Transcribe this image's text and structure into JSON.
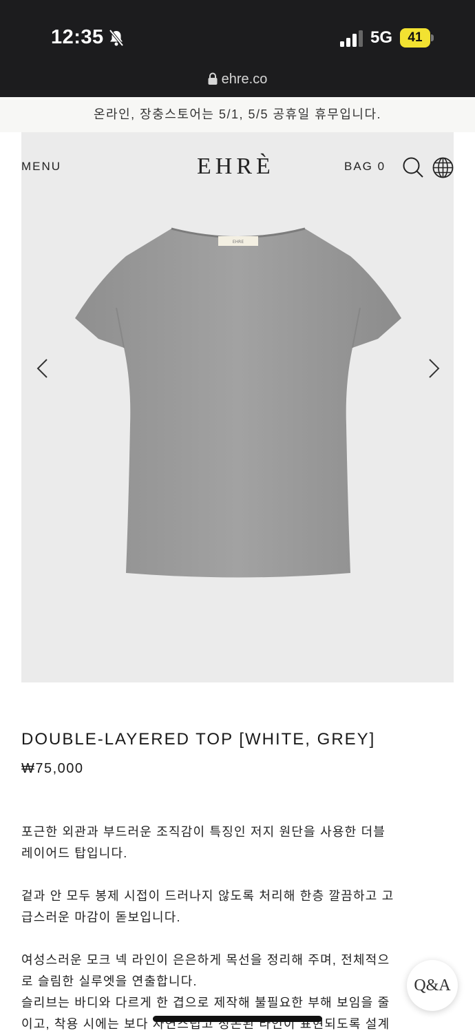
{
  "status_bar": {
    "time": "12:35",
    "network": "5G",
    "battery": "41",
    "bell_icon": "bell-slash-icon",
    "signal_icon": "cellular-signal-icon"
  },
  "url_bar": {
    "domain": "ehre.co",
    "lock_icon": "lock-icon"
  },
  "announcement": "온라인, 장충스토어는 5/1, 5/5 공휴일 휴무입니다.",
  "header": {
    "menu_label": "MENU",
    "logo": "EHRÈ",
    "bag_label": "BAG 0",
    "search_icon": "search-icon",
    "language_icon": "globe-icon"
  },
  "gallery": {
    "prev_icon": "chevron-left-icon",
    "next_icon": "chevron-right-icon",
    "image_subject": "grey boat-neck short-sleeve top"
  },
  "product": {
    "title": "DOUBLE-LAYERED TOP [WHITE, GREY]",
    "price": "₩75,000",
    "description": [
      "포근한 외관과 부드러운 조직감이 특징인 저지 원단을 사용한 더블\n레이어드 탑입니다.",
      "겉과 안 모두 봉제 시접이 드러나지 않도록 처리해 한층 깔끔하고 고\n급스러운 마감이 돋보입니다.",
      "여성스러운 모크 넥 라인이 은은하게 목선을 정리해 주며, 전체적으\n로 슬림한 실루엣을 연출합니다.\n슬리브는 바디와 다르게 한 겹으로 제작해 불필요한 부해 보임을 줄\n이고, 착용 시에는 보다 자연스럽고 정돈된 라인이 표현되도록 설계"
    ]
  },
  "qa_button": "Q&A",
  "colors": {
    "status_bg": "#1c1c1e",
    "battery": "#f2e231",
    "hero_bg": "#ebebeb",
    "shirt": "#9a9a9a"
  }
}
